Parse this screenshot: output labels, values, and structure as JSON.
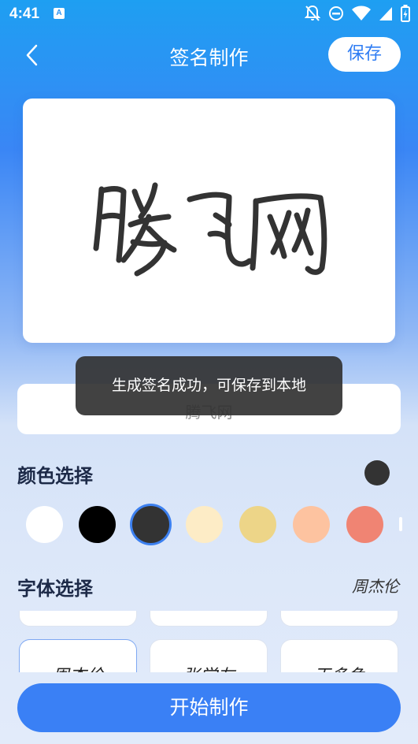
{
  "status_bar": {
    "time": "4:41",
    "notification_icon_label": "A",
    "icons": [
      "notifications-off-icon",
      "do-not-disturb-icon",
      "wifi-icon",
      "signal-icon",
      "battery-icon"
    ]
  },
  "header": {
    "title": "签名制作",
    "save_label": "保存"
  },
  "signature": {
    "text": "腾飞网",
    "color": "#333333"
  },
  "name_input": {
    "value": "腾飞网"
  },
  "toast": {
    "message": "生成签名成功，可保存到本地"
  },
  "color_section": {
    "title": "颜色选择",
    "current_color": "#333333",
    "swatches": [
      {
        "color": "#ffffff",
        "selected": false
      },
      {
        "color": "#000000",
        "selected": false
      },
      {
        "color": "#333333",
        "selected": true
      },
      {
        "color": "#fdecc6",
        "selected": false
      },
      {
        "color": "#edd588",
        "selected": false
      },
      {
        "color": "#fdc3a0",
        "selected": false
      },
      {
        "color": "#f08473",
        "selected": false
      }
    ]
  },
  "font_section": {
    "title": "字体选择",
    "current_font_preview": "周杰伦",
    "fonts": [
      {
        "label": "周杰伦",
        "selected": true
      },
      {
        "label": "张学友",
        "selected": false
      },
      {
        "label": "王多鱼",
        "selected": false
      }
    ]
  },
  "start_button": {
    "label": "开始制作"
  },
  "colors": {
    "accent": "#3a80f5",
    "header_gradient_top": "#1e9ff2"
  }
}
